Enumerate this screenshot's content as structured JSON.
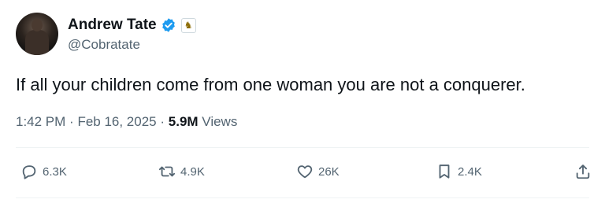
{
  "author": {
    "name": "Andrew Tate",
    "handle": "@Cobratate",
    "verified_color": "#1d9bf0"
  },
  "tweet": {
    "text": "If all your children come from one woman you are not a conquerer.",
    "time": "1:42 PM",
    "date": "Feb 16, 2025",
    "views_count": "5.9M",
    "views_label": "Views"
  },
  "actions": {
    "replies": "6.3K",
    "retweets": "4.9K",
    "likes": "26K",
    "bookmarks": "2.4K"
  }
}
